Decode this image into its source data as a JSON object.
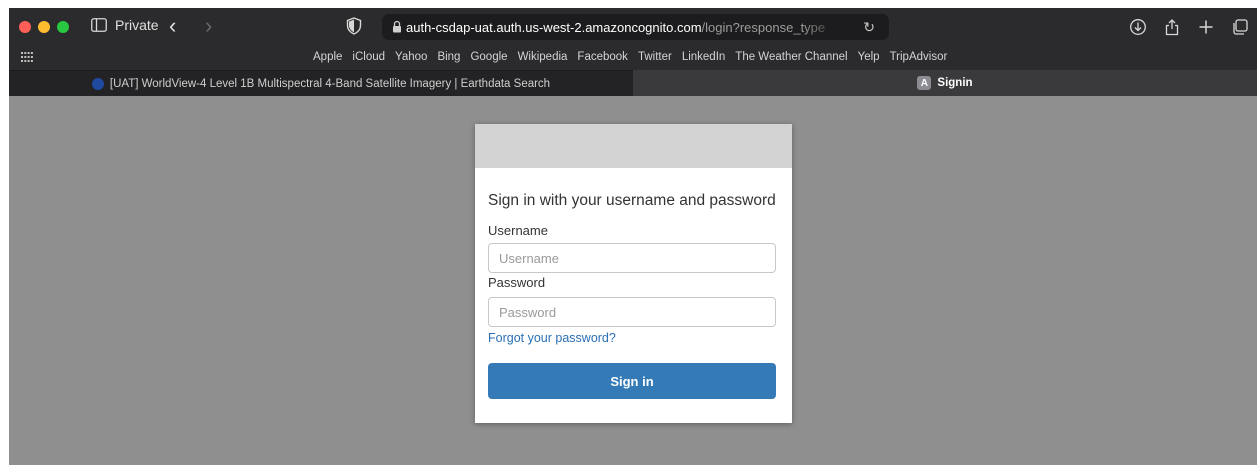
{
  "toolbar": {
    "private_label": "Private",
    "url_host": "auth-csdap-uat.auth.us-west-2.amazoncognito.com",
    "url_path": "/login?response_type=code"
  },
  "favorites": [
    "Apple",
    "iCloud",
    "Yahoo",
    "Bing",
    "Google",
    "Wikipedia",
    "Facebook",
    "Twitter",
    "LinkedIn",
    "The Weather Channel",
    "Yelp",
    "TripAdvisor"
  ],
  "tabs": [
    {
      "title": "[UAT] WorldView-4 Level 1B Multispectral 4-Band Satellite Imagery | Earthdata Search",
      "favicon": "nasa-icon",
      "active": false
    },
    {
      "title": "Signin",
      "favicon_letter": "A",
      "favicon": "a-icon",
      "active": true
    }
  ],
  "signin": {
    "heading": "Sign in with your username and password",
    "username_label": "Username",
    "username_placeholder": "Username",
    "password_label": "Password",
    "password_placeholder": "Password",
    "forgot_link": "Forgot your password?",
    "submit_label": "Sign in"
  },
  "colors": {
    "page_bg": "#8f8f8f",
    "button": "#337ab7",
    "link": "#2a6fb5",
    "card_header": "#d3d3d3"
  }
}
